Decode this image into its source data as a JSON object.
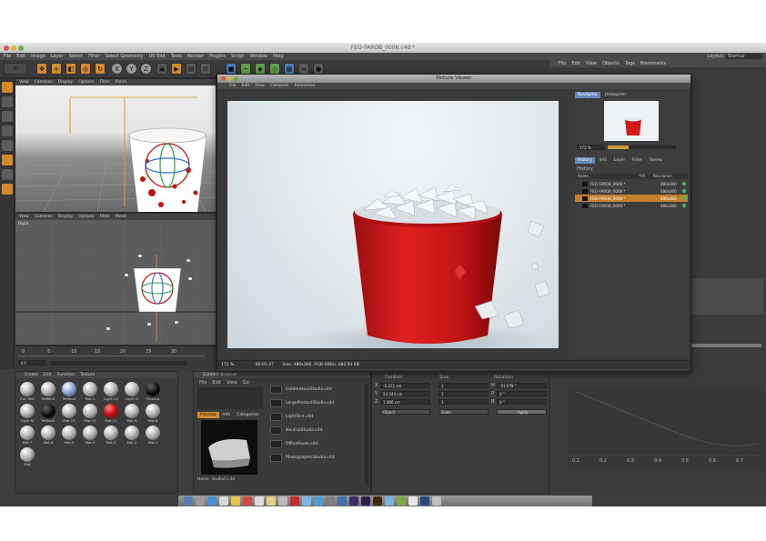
{
  "window": {
    "title": "FEO-FAROB_0008.c4d *"
  },
  "menubar": [
    "File",
    "Edit",
    "Image",
    "Layer",
    "Select",
    "Filter",
    "Select Geometry",
    "UV Edit",
    "Tools",
    "Render",
    "Plugins",
    "Script",
    "Window",
    "Help"
  ],
  "layout": {
    "label": "Layout:",
    "value": "Startup"
  },
  "toolbar": {
    "axis": [
      "X",
      "Y",
      "Z"
    ]
  },
  "viewport_top": {
    "menu": [
      "View",
      "Cameras",
      "Display",
      "Options",
      "Filter",
      "Panel"
    ]
  },
  "viewport_bottom": {
    "menu": [
      "View",
      "Cameras",
      "Display",
      "Options",
      "Filter",
      "Panel"
    ],
    "label": "Right"
  },
  "timeline": {
    "ticks": [
      "0",
      "5",
      "10",
      "15",
      "20",
      "25",
      "30"
    ],
    "frame": "0 F"
  },
  "material_manager": {
    "menu": [
      "Create",
      "Edit",
      "Function",
      "Texture"
    ],
    "materials": [
      {
        "label": "Ext. Mat",
        "kind": "white"
      },
      {
        "label": "Reflecti",
        "kind": "white"
      },
      {
        "label": "Reflecti",
        "kind": "blue"
      },
      {
        "label": "Mat.1",
        "kind": "white"
      },
      {
        "label": "Light Ca",
        "kind": "white"
      },
      {
        "label": "Light M",
        "kind": "white"
      },
      {
        "label": "Plastica",
        "kind": "black"
      },
      {
        "label": "Light M",
        "kind": "white"
      },
      {
        "label": "Reflecti",
        "kind": "black"
      },
      {
        "label": "Mat.15",
        "kind": "white"
      },
      {
        "label": "Mat.13",
        "kind": "white"
      },
      {
        "label": "Mat.11",
        "kind": "red"
      },
      {
        "label": "Mat.9",
        "kind": "white"
      },
      {
        "label": "Mat.8",
        "kind": "white"
      },
      {
        "label": "Mat.7",
        "kind": "white"
      },
      {
        "label": "Mat.6",
        "kind": "white"
      },
      {
        "label": "Mat.5",
        "kind": "white"
      },
      {
        "label": "Mat.4",
        "kind": "white"
      },
      {
        "label": "Mat.3",
        "kind": "white"
      },
      {
        "label": "Mat.2",
        "kind": "white"
      },
      {
        "label": "Mat.1",
        "kind": "white"
      },
      {
        "label": "Mat",
        "kind": "white"
      }
    ]
  },
  "content_browser": {
    "title": "Content Browser",
    "menu": [
      "File",
      "Edit",
      "View",
      "Go"
    ],
    "tabs": [
      "Preview",
      "Info",
      "Categories"
    ],
    "preview_name": "Name: Studio5.c4d",
    "items": [
      "GoldenHourStudio.c4d",
      "LargeProductStudio.c4d",
      "LightTent.c4d",
      "NeutralStudio.c4d",
      "OfficeRoom.c4d",
      "PhotographicStudio.c4d"
    ]
  },
  "attributes": {
    "headers": [
      "Position",
      "Size",
      "Rotation"
    ],
    "rows": [
      {
        "axis": "X",
        "pos": "-0.212 cm",
        "size": "1",
        "rot_axis": "H",
        "rot": "-51.078 °"
      },
      {
        "axis": "Y",
        "pos": "54.544 cm",
        "size": "1",
        "rot_axis": "P",
        "rot": "0 °"
      },
      {
        "axis": "Z",
        "pos": "1.066 cm",
        "size": "1",
        "rot_axis": "B",
        "rot": "0 °"
      }
    ],
    "dropdowns": [
      "Object",
      "Scale"
    ],
    "apply": "Apply"
  },
  "right_panel": {
    "menu": [
      "File",
      "Edit",
      "View",
      "Objects",
      "Tags",
      "Bookmarks"
    ],
    "graph_ticks": [
      "0.1",
      "0.2",
      "0.3",
      "0.4",
      "0.5",
      "0.6",
      "0.7"
    ]
  },
  "picture_viewer": {
    "title": "Picture Viewer",
    "menu": [
      "File",
      "Edit",
      "View",
      "Compare",
      "Animation"
    ],
    "nav_tabs": [
      "Navigator",
      "Histogram"
    ],
    "zoom": "172 %",
    "hist_tabs": [
      "History",
      "Info",
      "Layer",
      "Filter",
      "Stereo"
    ],
    "history_title": "History",
    "history_headers": [
      "Name",
      "*FR",
      "Resolution"
    ],
    "history": [
      {
        "name": "FEO-FAROB_0008 *",
        "res": "480x360",
        "dot": "#3fbf5f",
        "selected": false
      },
      {
        "name": "FEO-FAROB_0008 *",
        "res": "480x360",
        "dot": "#3fbf5f",
        "selected": false
      },
      {
        "name": "FEO-FAROB_0008 *",
        "res": "480x360",
        "dot": "#3fbf5f",
        "selected": true
      },
      {
        "name": "FEO-FAROB_0008 *",
        "res": "480x360",
        "dot": "#3fbf5f",
        "selected": false
      }
    ],
    "status": {
      "zoom": "172 %",
      "time": "00:01:47",
      "info": "Size: 480x360, RGB (8Bit), 682.91 KB"
    }
  },
  "dock": {
    "colors": [
      "#5b7fb0",
      "#9a9a9a",
      "#4a8fd4",
      "#d8d8d8",
      "#e8c54a",
      "#d04a4a",
      "#dcdcdc",
      "#e8d07a",
      "#bbbbbb",
      "#cc2a2a",
      "#7db7e8",
      "#4c9cd8",
      "#7e7e7e",
      "#3f6fb0",
      "#3a2a6a",
      "#2a1f4a",
      "#3d2a0a",
      "#79b0e0",
      "#7ca84a",
      "#e8e8e8",
      "#2a4a7a",
      "#c0c0c0"
    ]
  }
}
